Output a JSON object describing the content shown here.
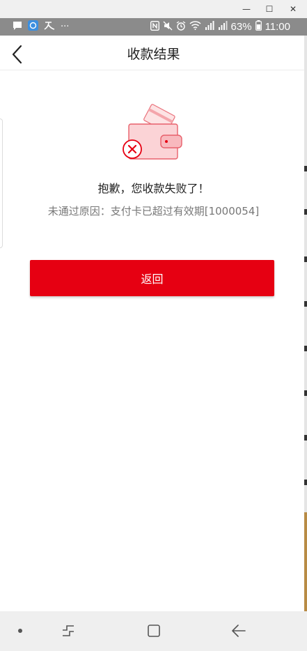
{
  "window": {
    "minimize_label": "—",
    "maximize_label": "☐",
    "close_label": "✕"
  },
  "status_bar": {
    "left_icons": [
      "message-icon",
      "browser-icon",
      "app-icon",
      "more-icon"
    ],
    "more_label": "···",
    "battery_percent": "63%",
    "time": "11:00",
    "right_icons": [
      "nfc-icon",
      "mute-icon",
      "alarm-icon",
      "wifi-icon",
      "signal-icon",
      "signal-icon",
      "battery-icon"
    ]
  },
  "header": {
    "title": "收款结果"
  },
  "result": {
    "title": "抱歉，您收款失败了！",
    "reason": "未通过原因：支付卡已超过有效期[1000054]",
    "illustration_colors": {
      "wallet_fill": "#fbd3d6",
      "wallet_stroke": "#e60012",
      "card_fill": "#fde3e4"
    }
  },
  "actions": {
    "return_label": "返回"
  },
  "colors": {
    "accent": "#e60012",
    "status_bar": "#8b8b8b"
  },
  "bottom_nav": {
    "items": [
      "dot-icon",
      "recent-apps-icon",
      "home-icon",
      "back-icon"
    ]
  }
}
